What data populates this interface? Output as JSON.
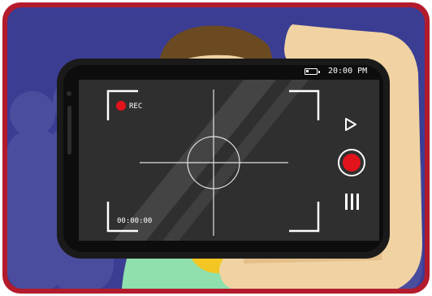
{
  "camera_ui": {
    "status_time": "20:00 PM",
    "rec_label": "REC",
    "timecode": "00:00:00",
    "battery_level": 0.3,
    "record_button_color": "#e1131b"
  },
  "icons": {
    "battery": "battery-icon",
    "recording_dot": "recording-dot-icon",
    "play": "play-icon",
    "record": "record-button-icon",
    "menu": "menu-bars-icon"
  },
  "colors": {
    "frame_border": "#b31b2c",
    "background": "#3b3d93",
    "skin": "#f1d3a3",
    "shirt": "#8fe0ad",
    "hair": "#6b4a22",
    "phone_body": "#1a1a1a",
    "smiley": "#f3c624"
  }
}
